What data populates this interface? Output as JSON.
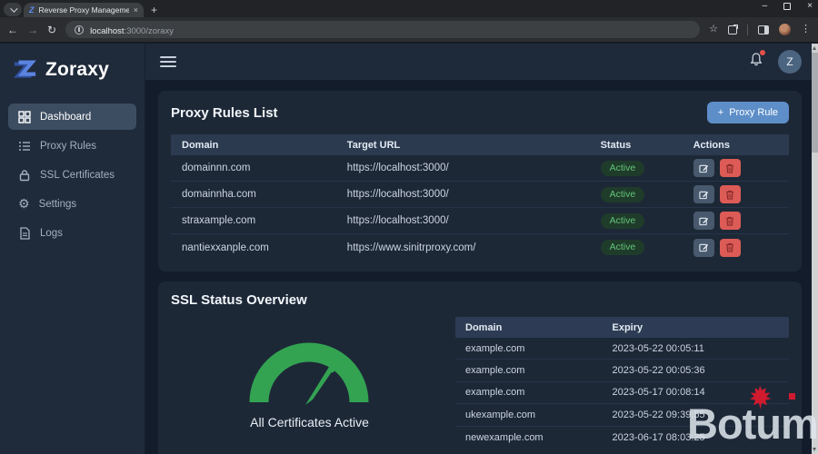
{
  "browser": {
    "tab_title": "Reverse Proxy Management",
    "favicon_letter": "Z",
    "url_host": "localhost",
    "url_rest": ":3000/zoraxy",
    "icons": {
      "back": "←",
      "forward": "→",
      "reload": "↻",
      "star": "☆",
      "overflow": "⋮",
      "minimize": "–",
      "close": "×",
      "tab_close": "×",
      "new_tab": "+"
    }
  },
  "app": {
    "logo_text": "Zoraxy",
    "sidebar": {
      "items": [
        {
          "label": "Dashboard",
          "active": true
        },
        {
          "label": "Proxy Rules",
          "active": false
        },
        {
          "label": "SSL Certificates",
          "active": false
        },
        {
          "label": "Settings",
          "active": false
        },
        {
          "label": "Logs",
          "active": false
        }
      ],
      "gear_glyph": "⚙"
    },
    "header": {
      "avatar_initial": "Z"
    }
  },
  "proxy_card": {
    "title": "Proxy Rules List",
    "add_button": {
      "plus": "+",
      "label": "Proxy Rule"
    },
    "columns": [
      "Domain",
      "Target URL",
      "Status",
      "Actions"
    ],
    "rows": [
      {
        "domain": "domainnn.com",
        "target": "https://localhost:3000/",
        "status": "Active"
      },
      {
        "domain": "domainnha.com",
        "target": "https://localhost:3000/",
        "status": "Active"
      },
      {
        "domain": "straxample.com",
        "target": "https://localhost:3000/",
        "status": "Active"
      },
      {
        "domain": "nantiexxanple.com",
        "target": "https://www.sinitrproxy.com/",
        "status": "Active"
      }
    ]
  },
  "ssl_card": {
    "title": "SSL Status Overview",
    "gauge_label": "All Certificates Active",
    "columns": [
      "Domain",
      "Expiry"
    ],
    "rows": [
      {
        "domain": "example.com",
        "expiry": "2023-05-22 00:05:11"
      },
      {
        "domain": "example.com",
        "expiry": "2023-05-22 00:05:36"
      },
      {
        "domain": "example.com",
        "expiry": "2023-05-17 00:08:14"
      },
      {
        "domain": "ukexample.com",
        "expiry": "2023-05-22 09:39:55"
      },
      {
        "domain": "newexample.com",
        "expiry": "2023-06-17 08:03:25"
      }
    ]
  },
  "watermark": {
    "text": "Botum"
  },
  "colors": {
    "accent_blue": "#5d8ec8",
    "gauge_green": "#33a352",
    "status_green_text": "#63c377",
    "status_green_bg": "#1f3c2b",
    "delete_red": "#dc5b56",
    "sidebar_bg": "#1f2a3a",
    "card_bg": "#1d2837",
    "watermark_red": "#d01a2e"
  }
}
